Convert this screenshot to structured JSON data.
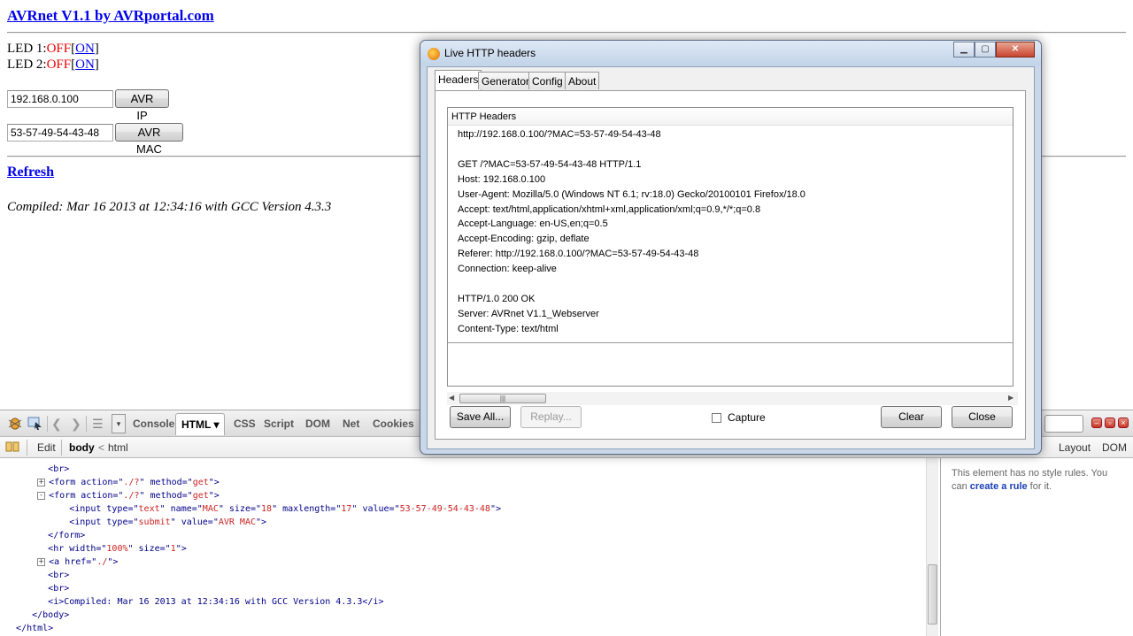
{
  "webpage": {
    "title": "AVRnet V1.1 by AVRportal.com",
    "leds": [
      {
        "label": "LED 1:",
        "off": "OFF",
        "on_open": "[",
        "on": "ON",
        "on_close": "]"
      },
      {
        "label": "LED 2:",
        "off": "OFF",
        "on_open": "[",
        "on": "ON",
        "on_close": "]"
      }
    ],
    "ip_input": "192.168.0.100",
    "ip_button": "AVR IP",
    "mac_input": "53-57-49-54-43-48",
    "mac_button": "AVR MAC",
    "refresh": "Refresh",
    "compiled": "Compiled: Mar 16 2013 at 12:34:16 with GCC Version 4.3.3"
  },
  "firebug": {
    "tabs": [
      "Console",
      "HTML",
      "CSS",
      "Script",
      "DOM",
      "Net",
      "Cookies"
    ],
    "active_tab": "HTML",
    "html_dropdown_arrow": "▾",
    "breadcrumb": {
      "edit": "Edit",
      "body": "body",
      "separator": "<",
      "html": "html"
    },
    "side_tabs": [
      "Layout",
      "DOM"
    ],
    "side_text_1": "This element has no style rules. You can ",
    "side_link": "create a rule",
    "side_text_2": " for it.",
    "html_lines": [
      {
        "indent": "        ",
        "twisty": "",
        "text": "<br>"
      },
      {
        "indent": "      ",
        "twisty": "+",
        "text": "<form action=\"./?\" method=\"get\">"
      },
      {
        "indent": "      ",
        "twisty": "-",
        "text": "<form action=\"./?\" method=\"get\">"
      },
      {
        "indent": "            ",
        "twisty": "",
        "text": "<input type=\"text\" name=\"MAC\" size=\"18\" maxlength=\"17\" value=\"53-57-49-54-43-48\">"
      },
      {
        "indent": "            ",
        "twisty": "",
        "text": "<input type=\"submit\" value=\"AVR MAC\">"
      },
      {
        "indent": "        ",
        "twisty": "",
        "text": "</form>"
      },
      {
        "indent": "        ",
        "twisty": "",
        "text": "<hr width=\"100%\" size=\"1\">"
      },
      {
        "indent": "      ",
        "twisty": "+",
        "text": "<a href=\"./\">"
      },
      {
        "indent": "        ",
        "twisty": "",
        "text": "<br>"
      },
      {
        "indent": "        ",
        "twisty": "",
        "text": "<br>"
      },
      {
        "indent": "        ",
        "twisty": "",
        "text": "<i>Compiled: Mar 16 2013 at 12:34:16 with GCC Version 4.3.3</i>"
      },
      {
        "indent": "     ",
        "twisty": "",
        "text": "</body>"
      },
      {
        "indent": "  ",
        "twisty": "",
        "text": "</html>"
      }
    ]
  },
  "dialog": {
    "title": "Live HTTP headers",
    "tabs": [
      "Headers",
      "Generator",
      "Config",
      "About"
    ],
    "active_tab": "Headers",
    "caption": "HTTP Headers",
    "header_lines": [
      "http://192.168.0.100/?MAC=53-57-49-54-43-48",
      "",
      "GET /?MAC=53-57-49-54-43-48 HTTP/1.1",
      "Host: 192.168.0.100",
      "User-Agent: Mozilla/5.0 (Windows NT 6.1; rv:18.0) Gecko/20100101 Firefox/18.0",
      "Accept: text/html,application/xhtml+xml,application/xml;q=0.9,*/*;q=0.8",
      "Accept-Language: en-US,en;q=0.5",
      "Accept-Encoding: gzip, deflate",
      "Referer: http://192.168.0.100/?MAC=53-57-49-54-43-48",
      "Connection: keep-alive",
      "",
      "HTTP/1.0 200 OK",
      "Server: AVRnet V1.1_Webserver",
      "Content-Type: text/html"
    ],
    "buttons": {
      "save_all": "Save All...",
      "replay": "Replay...",
      "clear": "Clear",
      "close": "Close"
    },
    "capture_label": "Capture",
    "capture_checked": false
  }
}
